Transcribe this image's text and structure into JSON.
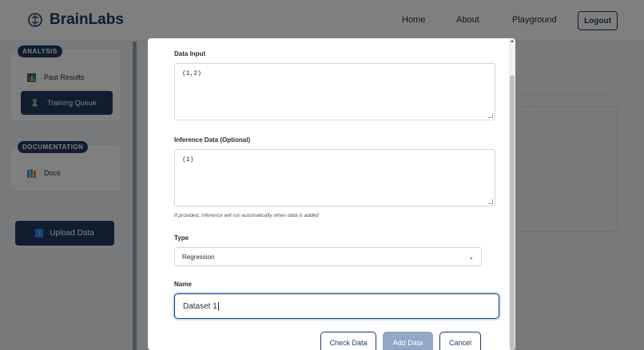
{
  "header": {
    "brand": "BrainLabs",
    "nav": [
      "Home",
      "About",
      "Playground"
    ],
    "logout_label": "Logout"
  },
  "sidebar": {
    "analysis_label": "ANALYSIS",
    "analysis_items": [
      {
        "label": "Past Results",
        "icon": "bar-chart-icon"
      },
      {
        "label": "Training Queue",
        "icon": "hourglass-icon",
        "active": true
      }
    ],
    "documentation_label": "DOCUMENTATION",
    "documentation_items": [
      {
        "label": "Docs",
        "icon": "books-icon"
      }
    ],
    "upload_label": "Upload Data"
  },
  "modal": {
    "data_input": {
      "label": "Data Input",
      "value": "(1,2)"
    },
    "inference": {
      "label": "Inference Data (Optional)",
      "value": "(1)"
    },
    "hint": "If provided, inference will run automatically when data is added",
    "type": {
      "label": "Type",
      "selected": "Regression"
    },
    "name": {
      "label": "Name",
      "value": "Dataset 1"
    },
    "buttons": {
      "check": "Check Data",
      "add": "Add Data",
      "cancel": "Cancel"
    }
  },
  "colors": {
    "primary": "#1e3a5f",
    "disabled": "#93a7c6",
    "overlay": "rgba(0,0,0,0.5)"
  }
}
